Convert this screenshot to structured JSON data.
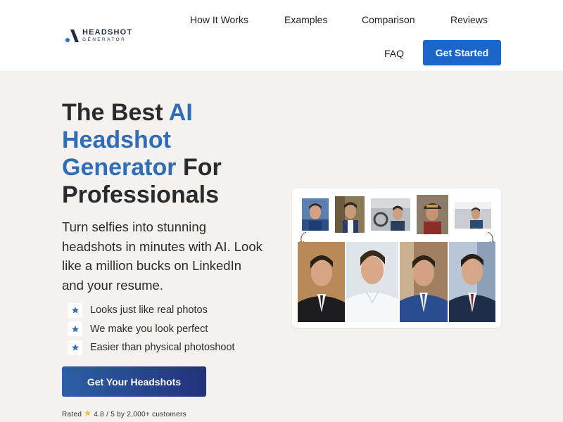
{
  "logo": {
    "line1": "HEADSHOT",
    "line2": "GENERATOR"
  },
  "nav": {
    "items": [
      {
        "label": "How It Works"
      },
      {
        "label": "Examples"
      },
      {
        "label": "Comparison"
      },
      {
        "label": "Reviews"
      },
      {
        "label": "FAQ"
      }
    ],
    "cta_label": "Get Started"
  },
  "hero": {
    "title_part1": "The Best ",
    "title_accent": "AI Headshot Generator",
    "title_part2": " For Professionals",
    "subtitle": "Turn selfies into stunning headshots in minutes with AI. Look like a million bucks on LinkedIn and your resume.",
    "features": [
      {
        "text": "Looks just like real photos"
      },
      {
        "text": "We make you look perfect"
      },
      {
        "text": "Easier than physical photoshoot"
      }
    ],
    "cta_label": "Get Your Headshots",
    "rating": {
      "prefix": "Rated",
      "score": "4.8 / 5",
      "suffix": "by 2,000+ customers"
    }
  },
  "colors": {
    "accent": "#2f6db8",
    "button": "#1d66c9",
    "background": "#f3f2f0"
  },
  "icons": {
    "feature": "star-icon",
    "rating": "gold-star-icon"
  }
}
